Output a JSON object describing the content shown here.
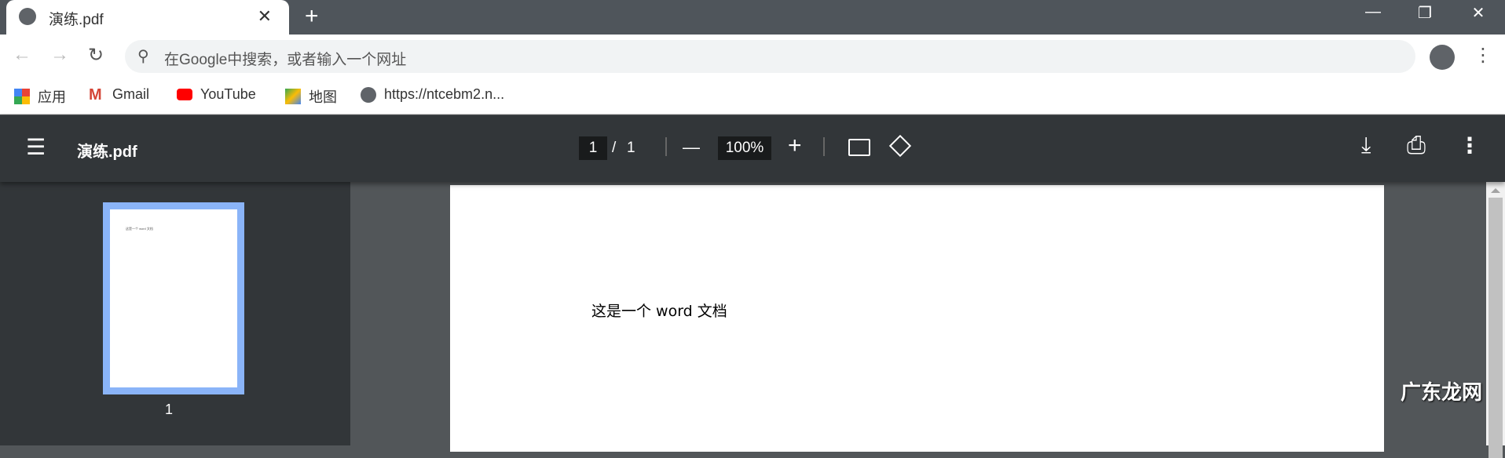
{
  "tab": {
    "title": "演练.pdf",
    "close": "✕",
    "new": "+"
  },
  "window": {
    "minimize": "—",
    "restore": "❐",
    "close": "✕"
  },
  "nav": {
    "back": "←",
    "forward": "→",
    "reload": "↻",
    "search_icon": "⚲",
    "placeholder": "在Google中搜索，或者输入一个网址",
    "more": "⋮"
  },
  "bookmarks": [
    {
      "label": "应用"
    },
    {
      "label": "Gmail"
    },
    {
      "label": "YouTube"
    },
    {
      "label": "地图"
    },
    {
      "label": "https://ntcebm2.n..."
    }
  ],
  "viewer": {
    "title": "演练.pdf",
    "page_current": "1",
    "page_sep": "/",
    "page_total": "1",
    "zoom": "100%",
    "minus": "—",
    "plus": "+",
    "menu": "☰",
    "download": "⤓",
    "print": "⎙",
    "more": "⋮"
  },
  "sidebar": {
    "thumb_label": "1"
  },
  "document": {
    "text": "这是一个 word 文档"
  },
  "watermark": "广东龙网",
  "colors": {
    "toolbar": "#323639",
    "thumb_border": "#8ab4f8",
    "tabbar": "#4f555b"
  }
}
